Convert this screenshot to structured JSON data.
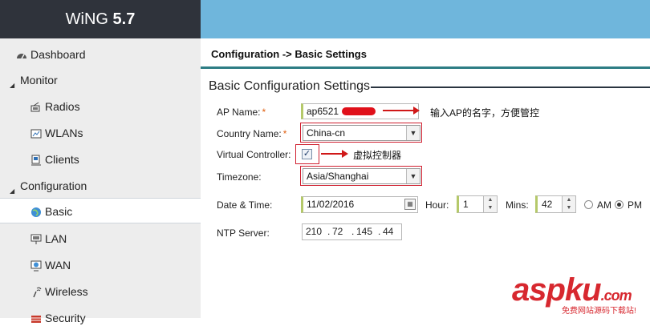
{
  "app": {
    "brand": "WiNG",
    "version": "5.7"
  },
  "sidebar": {
    "items": [
      {
        "label": "Dashboard",
        "icon": "dashboard-icon"
      },
      {
        "label": "Monitor",
        "icon": "expand-triangle-icon"
      },
      {
        "label": "Radios",
        "icon": "radio-icon"
      },
      {
        "label": "WLANs",
        "icon": "wlan-icon"
      },
      {
        "label": "Clients",
        "icon": "clients-icon"
      },
      {
        "label": "Configuration",
        "icon": "expand-triangle-icon"
      },
      {
        "label": "Basic",
        "icon": "globe-icon"
      },
      {
        "label": "LAN",
        "icon": "lan-icon"
      },
      {
        "label": "WAN",
        "icon": "wan-icon"
      },
      {
        "label": "Wireless",
        "icon": "wireless-icon"
      },
      {
        "label": "Security",
        "icon": "security-icon"
      }
    ]
  },
  "breadcrumb": "Configuration -> Basic Settings",
  "form": {
    "section_title": "Basic Configuration Settings",
    "ap_name_label": "AP Name:",
    "ap_name_value": "ap6521",
    "country_label": "Country Name:",
    "country_value": "China-cn",
    "vc_label": "Virtual Controller:",
    "vc_checked": true,
    "timezone_label": "Timezone:",
    "timezone_value": "Asia/Shanghai",
    "datetime_label": "Date & Time:",
    "date_value": "11/02/2016",
    "hour_label": "Hour:",
    "hour_value": "1",
    "mins_label": "Mins:",
    "mins_value": "42",
    "am_label": "AM",
    "pm_label": "PM",
    "pm_selected": true,
    "ntp_label": "NTP Server:",
    "ntp_octets": [
      "210",
      "72",
      "145",
      "44"
    ],
    "required_mark": "*"
  },
  "annotations": {
    "ap_name_note": "输入AP的名字，方便管控",
    "vc_note": "虚拟控制器"
  },
  "watermark": {
    "main_a": "asp",
    "main_b": "ku",
    "main_c": ".com",
    "sub": "免费网站源码下载站!"
  },
  "colors": {
    "sidebar_bg": "#ededed",
    "topbar": "#6fb6dc",
    "logo_bg": "#2f333b",
    "annotation": "#d01818"
  }
}
